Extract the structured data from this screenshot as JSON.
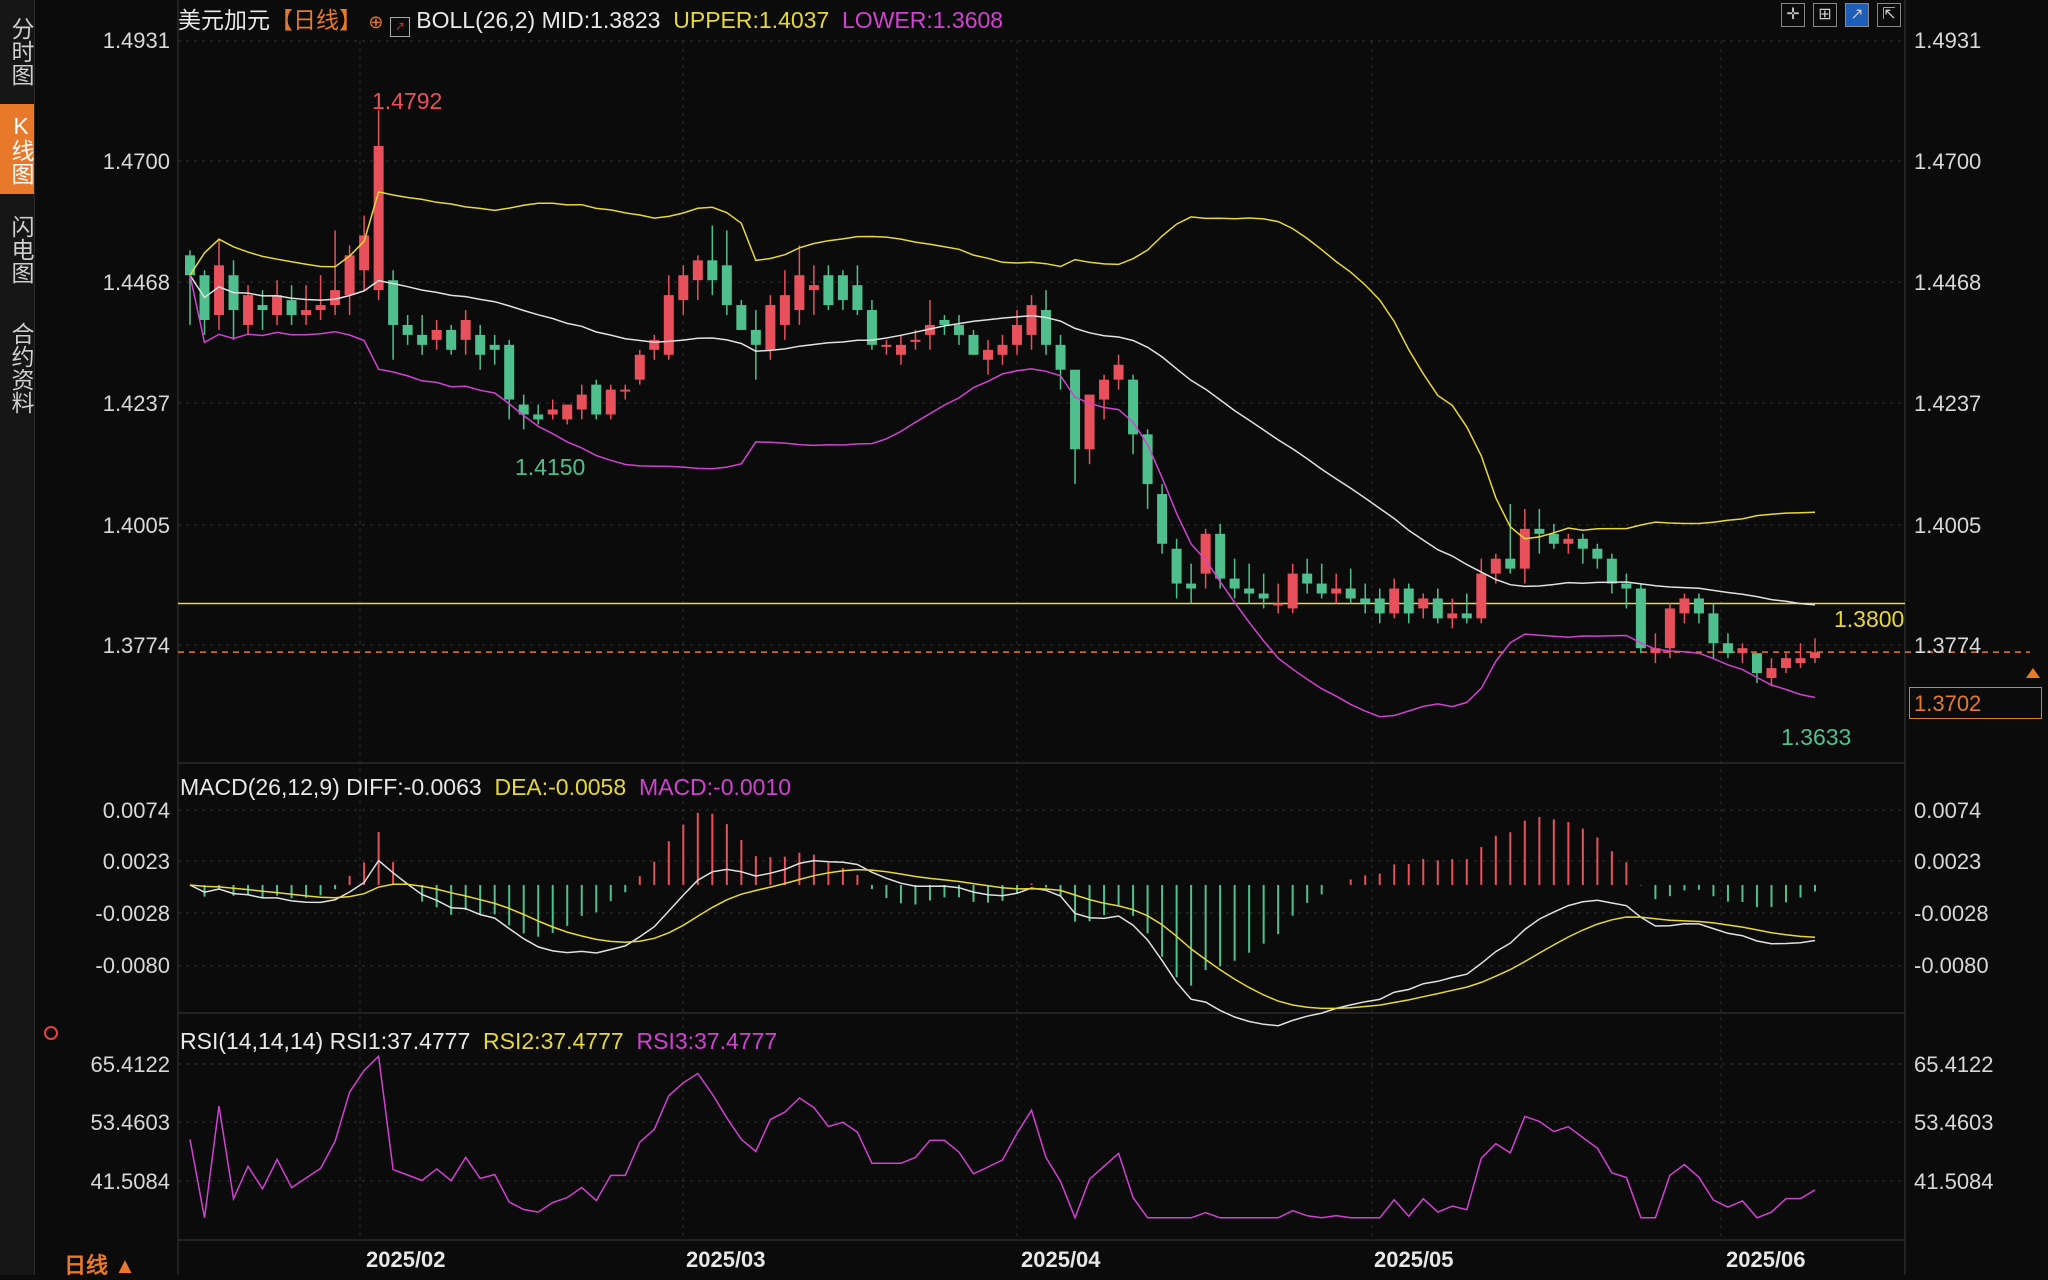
{
  "sidebar": {
    "items": [
      "分时图",
      "K线图",
      "闪电图",
      "合约资料"
    ],
    "active": 1
  },
  "header": {
    "symbol": "美元加元",
    "period_tag": "【日线】",
    "boll": {
      "name": "BOLL(26,2)",
      "mid": "MID:1.3823",
      "upper": "UPPER:1.4037",
      "lower": "LOWER:1.3608"
    }
  },
  "macd_header": {
    "name": "MACD(26,12,9)",
    "diff": "DIFF:-0.0063",
    "dea": "DEA:-0.0058",
    "macd": "MACD:-0.0010"
  },
  "rsi_header": {
    "name": "RSI(14,14,14)",
    "rsi1": "RSI1:37.4777",
    "rsi2": "RSI2:37.4777",
    "rsi3": "RSI3:37.4777"
  },
  "price_axis": [
    "1.4931",
    "1.4700",
    "1.4468",
    "1.4237",
    "1.4005",
    "1.3774"
  ],
  "macd_axis": [
    "0.0074",
    "0.0023",
    "-0.0028",
    "-0.0080"
  ],
  "rsi_axis": [
    "65.4122",
    "53.4603",
    "41.5084"
  ],
  "dates": [
    "2025/02",
    "2025/03",
    "2025/04",
    "2025/05",
    "2025/06"
  ],
  "annotations": {
    "high": "1.4792",
    "low1": "1.4150",
    "low2": "1.3633",
    "hline": "1.3800",
    "current": "1.3702"
  },
  "timeframe_label": "日线 ▲",
  "colors": {
    "up": "#e8505b",
    "down": "#4fc08d",
    "mid": "#e0e0e0",
    "upper": "#e6d83a",
    "lower": "#d042d0",
    "accent": "#e8792b"
  },
  "chart_data": {
    "type": "candlestick",
    "title": "美元加元【日线】",
    "price_ylim": [
      1.3633,
      1.4931
    ],
    "candles": [
      [
        1.45,
        1.451,
        1.436,
        1.446
      ],
      [
        1.446,
        1.447,
        1.434,
        1.437
      ],
      [
        1.438,
        1.453,
        1.435,
        1.448
      ],
      [
        1.446,
        1.449,
        1.433,
        1.439
      ],
      [
        1.436,
        1.444,
        1.434,
        1.442
      ],
      [
        1.44,
        1.443,
        1.435,
        1.439
      ],
      [
        1.438,
        1.445,
        1.436,
        1.442
      ],
      [
        1.441,
        1.444,
        1.436,
        1.438
      ],
      [
        1.438,
        1.444,
        1.436,
        1.439
      ],
      [
        1.439,
        1.446,
        1.437,
        1.44
      ],
      [
        1.44,
        1.455,
        1.438,
        1.443
      ],
      [
        1.442,
        1.452,
        1.438,
        1.45
      ],
      [
        1.447,
        1.458,
        1.443,
        1.454
      ],
      [
        1.443,
        1.4792,
        1.441,
        1.472
      ],
      [
        1.445,
        1.447,
        1.429,
        1.436
      ],
      [
        1.436,
        1.438,
        1.432,
        1.434
      ],
      [
        1.434,
        1.438,
        1.43,
        1.432
      ],
      [
        1.433,
        1.437,
        1.431,
        1.435
      ],
      [
        1.435,
        1.436,
        1.43,
        1.431
      ],
      [
        1.433,
        1.439,
        1.43,
        1.437
      ],
      [
        1.434,
        1.436,
        1.427,
        1.43
      ],
      [
        1.432,
        1.434,
        1.428,
        1.431
      ],
      [
        1.432,
        1.433,
        1.417,
        1.421
      ],
      [
        1.42,
        1.422,
        1.415,
        1.418
      ],
      [
        1.418,
        1.42,
        1.416,
        1.417
      ],
      [
        1.418,
        1.421,
        1.417,
        1.419
      ],
      [
        1.417,
        1.42,
        1.416,
        1.42
      ],
      [
        1.419,
        1.424,
        1.417,
        1.422
      ],
      [
        1.424,
        1.425,
        1.417,
        1.418
      ],
      [
        1.418,
        1.424,
        1.417,
        1.423
      ],
      [
        1.423,
        1.424,
        1.421,
        1.423
      ],
      [
        1.425,
        1.431,
        1.424,
        1.43
      ],
      [
        1.431,
        1.434,
        1.429,
        1.433
      ],
      [
        1.43,
        1.446,
        1.429,
        1.442
      ],
      [
        1.441,
        1.448,
        1.438,
        1.446
      ],
      [
        1.445,
        1.45,
        1.441,
        1.449
      ],
      [
        1.449,
        1.456,
        1.442,
        1.445
      ],
      [
        1.448,
        1.455,
        1.438,
        1.44
      ],
      [
        1.44,
        1.441,
        1.435,
        1.435
      ],
      [
        1.435,
        1.439,
        1.425,
        1.432
      ],
      [
        1.431,
        1.442,
        1.429,
        1.44
      ],
      [
        1.436,
        1.447,
        1.433,
        1.442
      ],
      [
        1.439,
        1.452,
        1.436,
        1.446
      ],
      [
        1.443,
        1.448,
        1.438,
        1.444
      ],
      [
        1.446,
        1.448,
        1.439,
        1.44
      ],
      [
        1.446,
        1.447,
        1.439,
        1.441
      ],
      [
        1.444,
        1.448,
        1.438,
        1.439
      ],
      [
        1.439,
        1.441,
        1.431,
        1.432
      ],
      [
        1.432,
        1.433,
        1.43,
        1.432
      ],
      [
        1.43,
        1.434,
        1.428,
        1.432
      ],
      [
        1.433,
        1.435,
        1.431,
        1.433
      ],
      [
        1.434,
        1.441,
        1.431,
        1.436
      ],
      [
        1.437,
        1.438,
        1.434,
        1.436
      ],
      [
        1.436,
        1.438,
        1.432,
        1.434
      ],
      [
        1.434,
        1.435,
        1.43,
        1.43
      ],
      [
        1.429,
        1.433,
        1.426,
        1.431
      ],
      [
        1.43,
        1.434,
        1.428,
        1.432
      ],
      [
        1.432,
        1.439,
        1.43,
        1.436
      ],
      [
        1.434,
        1.442,
        1.431,
        1.44
      ],
      [
        1.439,
        1.443,
        1.43,
        1.432
      ],
      [
        1.432,
        1.434,
        1.423,
        1.427
      ],
      [
        1.427,
        1.427,
        1.404,
        1.411
      ],
      [
        1.411,
        1.42,
        1.408,
        1.422
      ],
      [
        1.421,
        1.426,
        1.417,
        1.425
      ],
      [
        1.425,
        1.43,
        1.423,
        1.428
      ],
      [
        1.425,
        1.426,
        1.41,
        1.414
      ],
      [
        1.414,
        1.415,
        1.399,
        1.404
      ],
      [
        1.402,
        1.404,
        1.39,
        1.392
      ],
      [
        1.391,
        1.393,
        1.381,
        1.384
      ],
      [
        1.384,
        1.388,
        1.38,
        1.383
      ],
      [
        1.386,
        1.395,
        1.383,
        1.394
      ],
      [
        1.394,
        1.396,
        1.383,
        1.385
      ],
      [
        1.385,
        1.389,
        1.381,
        1.383
      ],
      [
        1.383,
        1.388,
        1.38,
        1.382
      ],
      [
        1.382,
        1.386,
        1.379,
        1.381
      ],
      [
        1.38,
        1.384,
        1.378,
        1.38
      ],
      [
        1.379,
        1.388,
        1.378,
        1.386
      ],
      [
        1.386,
        1.389,
        1.382,
        1.384
      ],
      [
        1.384,
        1.388,
        1.381,
        1.382
      ],
      [
        1.382,
        1.386,
        1.38,
        1.383
      ],
      [
        1.383,
        1.387,
        1.38,
        1.381
      ],
      [
        1.381,
        1.384,
        1.378,
        1.38
      ],
      [
        1.381,
        1.383,
        1.376,
        1.378
      ],
      [
        1.378,
        1.385,
        1.377,
        1.383
      ],
      [
        1.383,
        1.384,
        1.376,
        1.378
      ],
      [
        1.379,
        1.382,
        1.377,
        1.381
      ],
      [
        1.381,
        1.383,
        1.376,
        1.377
      ],
      [
        1.377,
        1.381,
        1.375,
        1.378
      ],
      [
        1.378,
        1.382,
        1.376,
        1.377
      ],
      [
        1.377,
        1.389,
        1.376,
        1.386
      ],
      [
        1.386,
        1.39,
        1.384,
        1.389
      ],
      [
        1.389,
        1.4,
        1.386,
        1.387
      ],
      [
        1.387,
        1.399,
        1.384,
        1.395
      ],
      [
        1.395,
        1.399,
        1.39,
        1.394
      ],
      [
        1.394,
        1.396,
        1.391,
        1.392
      ],
      [
        1.392,
        1.394,
        1.39,
        1.393
      ],
      [
        1.393,
        1.394,
        1.388,
        1.391
      ],
      [
        1.391,
        1.392,
        1.387,
        1.389
      ],
      [
        1.389,
        1.39,
        1.382,
        1.384
      ],
      [
        1.384,
        1.386,
        1.379,
        1.383
      ],
      [
        1.383,
        1.384,
        1.37,
        1.371
      ],
      [
        1.37,
        1.374,
        1.368,
        1.371
      ],
      [
        1.371,
        1.38,
        1.369,
        1.379
      ],
      [
        1.378,
        1.382,
        1.376,
        1.381
      ],
      [
        1.381,
        1.382,
        1.376,
        1.378
      ],
      [
        1.378,
        1.38,
        1.369,
        1.372
      ],
      [
        1.372,
        1.374,
        1.369,
        1.37
      ],
      [
        1.37,
        1.372,
        1.368,
        1.371
      ],
      [
        1.37,
        1.37,
        1.364,
        1.366
      ],
      [
        1.365,
        1.369,
        1.3633,
        1.367
      ],
      [
        1.367,
        1.37,
        1.366,
        1.369
      ],
      [
        1.368,
        1.372,
        1.367,
        1.369
      ],
      [
        1.369,
        1.373,
        1.368,
        1.3702
      ]
    ],
    "boll": {
      "mid": 1.3823,
      "upper": 1.4037,
      "lower": 1.3608
    },
    "macd": {
      "diff": -0.0063,
      "dea": -0.0058,
      "macd": -0.001,
      "ylim": [
        -0.012,
        0.0085
      ]
    },
    "rsi": {
      "rsi1": 37.4777,
      "rsi2": 37.4777,
      "rsi3": 37.4777,
      "ylim": [
        33.0,
        67.5
      ]
    },
    "reference_line": 1.38
  }
}
